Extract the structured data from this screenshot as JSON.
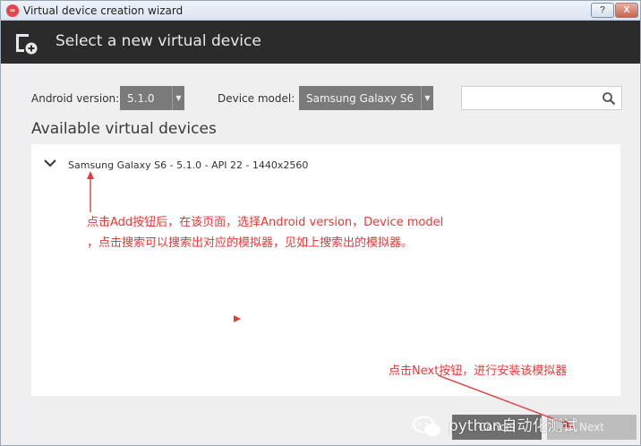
{
  "window": {
    "title": "Virtual device creation wizard",
    "help_label": "?",
    "close_label": "X"
  },
  "header": {
    "title": "Select a new virtual device"
  },
  "filters": {
    "android_version_label": "Android version:",
    "android_version_value": "5.1.0",
    "device_model_label": "Device model:",
    "device_model_value": "Samsung Galaxy S6",
    "search_value": ""
  },
  "section": {
    "title": "Available virtual devices"
  },
  "devices": [
    {
      "label": "Samsung Galaxy S6 - 5.1.0 - API 22 - 1440x2560"
    }
  ],
  "annotations": {
    "line1": "点击Add按钮后，在该页面，选择Android version，Device model",
    "line2": "，点击搜索可以搜索出对应的模拟器，见如上搜索出的模拟器。",
    "next_hint": "点击Next按钮，进行安装该模拟器"
  },
  "footer": {
    "cancel_label": "Cancel",
    "next_label": "Next"
  },
  "watermark": {
    "text": "python自动化测试"
  },
  "colors": {
    "header_bg": "#2b2b2b",
    "annotation": "#e53a3a",
    "select_bg": "#7a7a7a"
  }
}
